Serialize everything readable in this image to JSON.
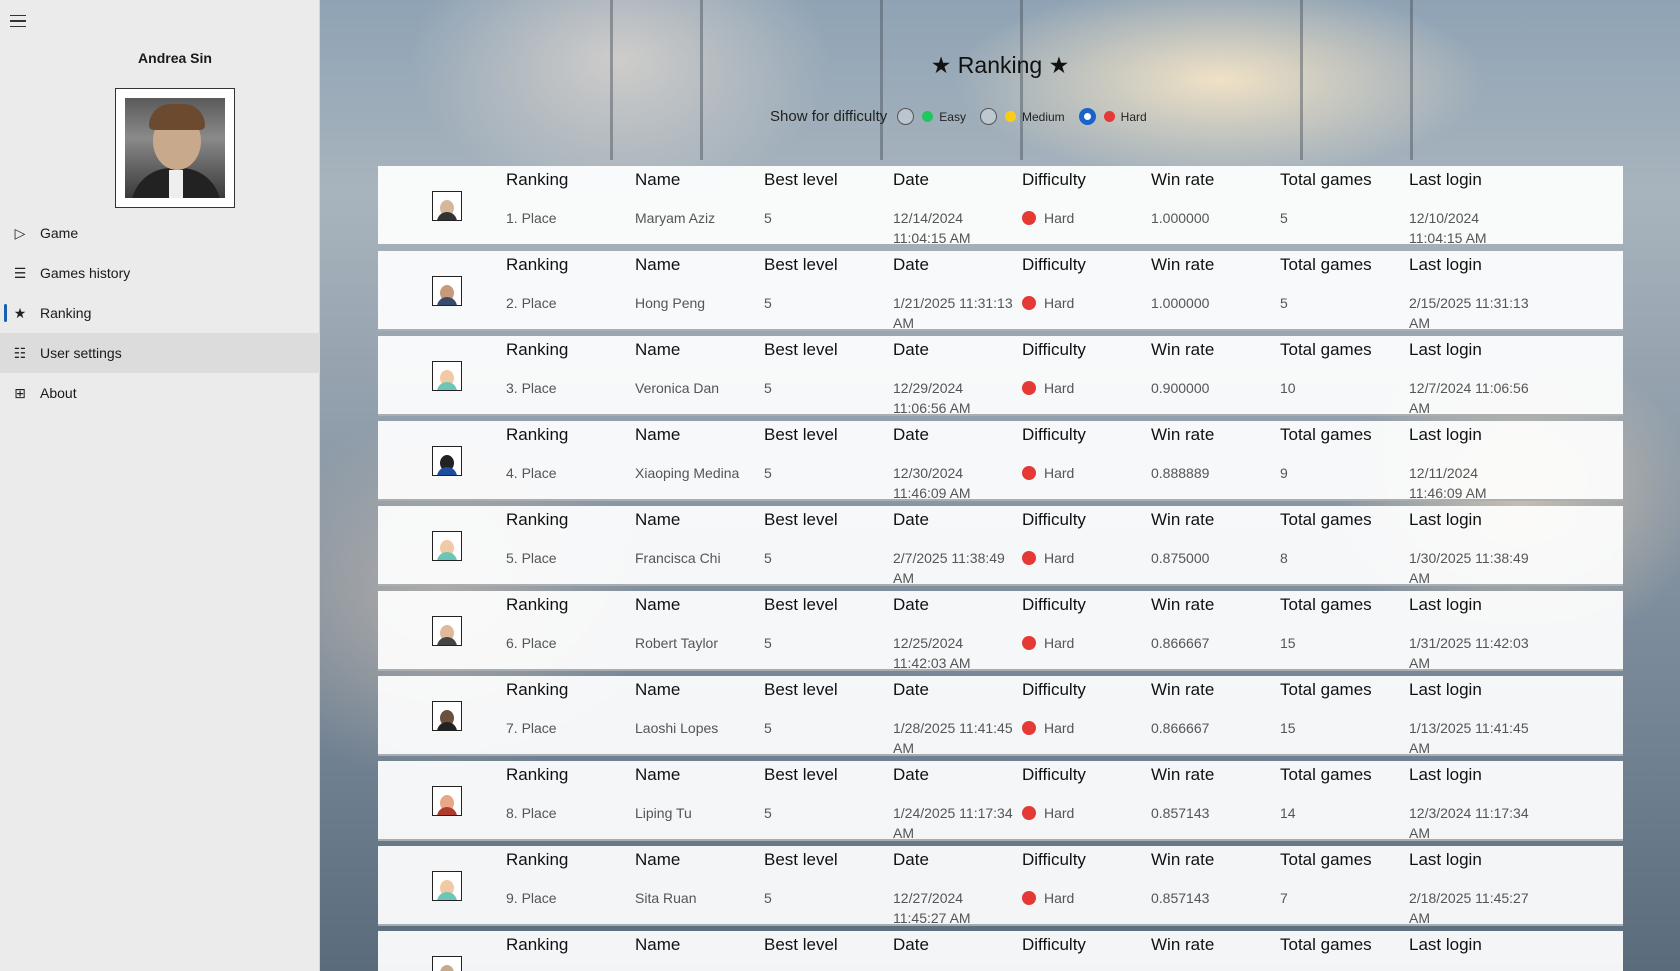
{
  "sidebar": {
    "user_name": "Andrea Sin",
    "nav": [
      {
        "label": "Game",
        "icon": "play-icon"
      },
      {
        "label": "Games history",
        "icon": "list-icon"
      },
      {
        "label": "Ranking",
        "icon": "star-icon"
      },
      {
        "label": "User settings",
        "icon": "user-list-icon"
      },
      {
        "label": "About",
        "icon": "grid-icon"
      }
    ],
    "selected": "Ranking"
  },
  "main": {
    "title": "★ Ranking ★",
    "filter": {
      "label": "Show for difficulty",
      "options": [
        {
          "label": "Easy",
          "color": "#22c55e",
          "checked": false
        },
        {
          "label": "Medium",
          "color": "#facc15",
          "checked": false
        },
        {
          "label": "Hard",
          "color": "#e53935",
          "checked": true
        }
      ]
    },
    "headers": {
      "ranking": "Ranking",
      "name": "Name",
      "best_level": "Best level",
      "date": "Date",
      "difficulty": "Difficulty",
      "win_rate": "Win rate",
      "total_games": "Total games",
      "last_login": "Last login"
    },
    "rows": [
      {
        "place": "1. Place",
        "name": "Maryam Aziz",
        "best_level": "5",
        "date": "12/14/2024 11:04:15 AM",
        "difficulty": "Hard",
        "win_rate": "1.000000",
        "total_games": "5",
        "last_login": "12/10/2024 11:04:15 AM"
      },
      {
        "place": "2. Place",
        "name": "Hong Peng",
        "best_level": "5",
        "date": "1/21/2025 11:31:13 AM",
        "difficulty": "Hard",
        "win_rate": "1.000000",
        "total_games": "5",
        "last_login": "2/15/2025 11:31:13 AM"
      },
      {
        "place": "3. Place",
        "name": "Veronica Dan",
        "best_level": "5",
        "date": "12/29/2024 11:06:56 AM",
        "difficulty": "Hard",
        "win_rate": "0.900000",
        "total_games": "10",
        "last_login": "12/7/2024 11:06:56 AM"
      },
      {
        "place": "4. Place",
        "name": "Xiaoping Medina",
        "best_level": "5",
        "date": "12/30/2024 11:46:09 AM",
        "difficulty": "Hard",
        "win_rate": "0.888889",
        "total_games": "9",
        "last_login": "12/11/2024 11:46:09 AM"
      },
      {
        "place": "5. Place",
        "name": "Francisca Chi",
        "best_level": "5",
        "date": "2/7/2025 11:38:49 AM",
        "difficulty": "Hard",
        "win_rate": "0.875000",
        "total_games": "8",
        "last_login": "1/30/2025 11:38:49 AM"
      },
      {
        "place": "6. Place",
        "name": "Robert Taylor",
        "best_level": "5",
        "date": "12/25/2024 11:42:03 AM",
        "difficulty": "Hard",
        "win_rate": "0.866667",
        "total_games": "15",
        "last_login": "1/31/2025 11:42:03 AM"
      },
      {
        "place": "7. Place",
        "name": "Laoshi Lopes",
        "best_level": "5",
        "date": "1/28/2025 11:41:45 AM",
        "difficulty": "Hard",
        "win_rate": "0.866667",
        "total_games": "15",
        "last_login": "1/13/2025 11:41:45 AM"
      },
      {
        "place": "8. Place",
        "name": "Liping Tu",
        "best_level": "5",
        "date": "1/24/2025 11:17:34 AM",
        "difficulty": "Hard",
        "win_rate": "0.857143",
        "total_games": "14",
        "last_login": "12/3/2024 11:17:34 AM"
      },
      {
        "place": "9. Place",
        "name": "Sita Ruan",
        "best_level": "5",
        "date": "12/27/2024 11:45:27 AM",
        "difficulty": "Hard",
        "win_rate": "0.857143",
        "total_games": "7",
        "last_login": "2/18/2025 11:45:27 AM"
      },
      {
        "place": "",
        "name": "",
        "best_level": "",
        "date": "",
        "difficulty": "",
        "win_rate": "",
        "total_games": "",
        "last_login": ""
      }
    ]
  }
}
